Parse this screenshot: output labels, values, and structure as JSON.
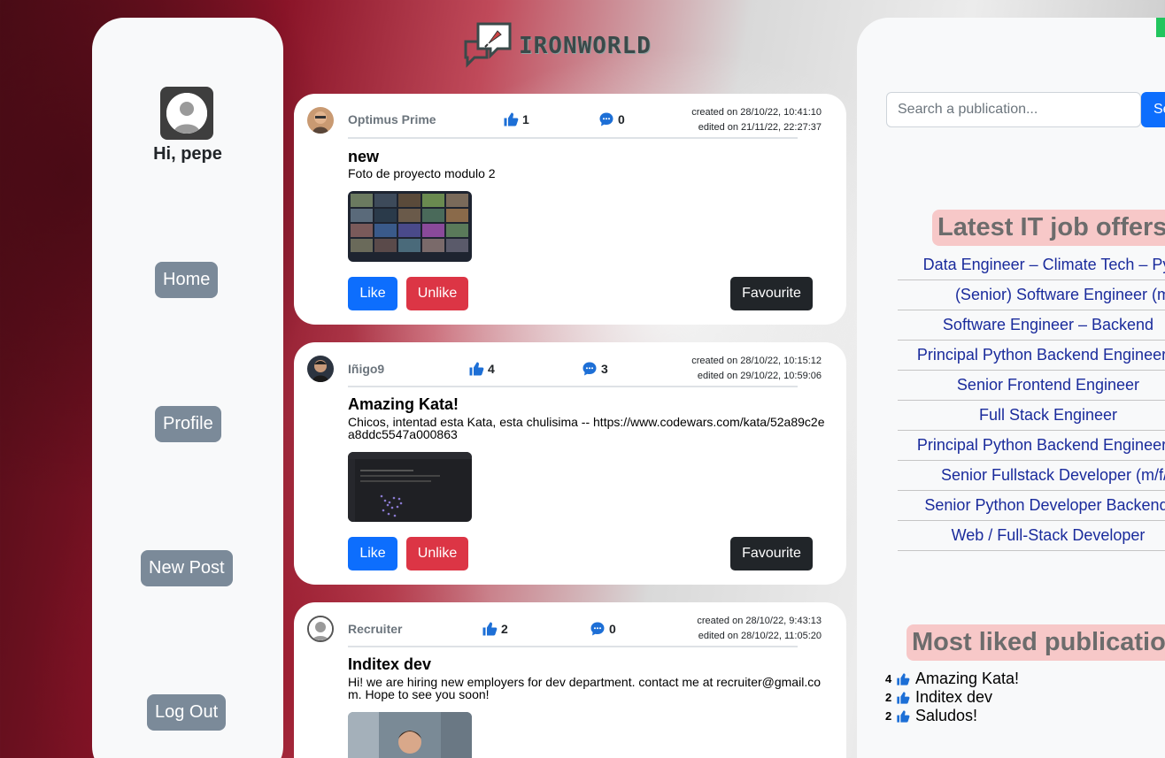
{
  "brand": {
    "name": "IRONWORLD"
  },
  "sidebar": {
    "greeting": "Hi, pepe",
    "nav": [
      "Home",
      "Profile",
      "New Post",
      "Log Out"
    ]
  },
  "posts": [
    {
      "author": "Optimus Prime",
      "likes": "1",
      "comments": "0",
      "created": "created on 28/10/22, 10:41:10",
      "edited": "edited on 21/11/22, 22:27:37",
      "title": "new",
      "body": "Foto de proyecto modulo 2",
      "like_label": "Like",
      "unlike_label": "Unlike",
      "fav_label": "Favourite"
    },
    {
      "author": "Iñigo9",
      "likes": "4",
      "comments": "3",
      "created": "created on 28/10/22, 10:15:12",
      "edited": "edited on 29/10/22, 10:59:06",
      "title": "Amazing Kata!",
      "body": "Chicos, intentad esta Kata, esta chulisima -- https://www.codewars.com/kata/52a89c2ea8ddc5547a000863",
      "like_label": "Like",
      "unlike_label": "Unlike",
      "fav_label": "Favourite"
    },
    {
      "author": "Recruiter",
      "likes": "2",
      "comments": "0",
      "created": "created on 28/10/22, 9:43:13",
      "edited": "edited on 28/10/22, 11:05:20",
      "title": "Inditex dev",
      "body": "Hi! we are hiring new employers for dev department. contact me at recruiter@gmail.com. Hope to see you soon!"
    }
  ],
  "search": {
    "placeholder": "Search a publication...",
    "button": "Se"
  },
  "jobs": {
    "title": "Latest IT job offers",
    "items": [
      "Data Engineer – Climate Tech – Pyth",
      "(Senior) Software Engineer (m/f/d)",
      "Software Engineer – Backend",
      "Principal Python Backend Engineer (m",
      "Senior Frontend Engineer",
      "Full Stack Engineer",
      "Principal Python Backend Engineer (m",
      "Senior Fullstack Developer (m/f/d)",
      "Senior Python Developer Backend (m",
      "Web / Full-Stack Developer"
    ]
  },
  "most_liked": {
    "title": "Most liked publication",
    "items": [
      {
        "count": "4",
        "title": "Amazing Kata!"
      },
      {
        "count": "2",
        "title": "Inditex dev"
      },
      {
        "count": "2",
        "title": "Saludos!"
      }
    ]
  },
  "colors": {
    "primary": "#0d6efd",
    "danger": "#dc3545",
    "dark": "#212529",
    "nav": "#7b8a99",
    "section_bg": "#f7c8c8",
    "job_link": "#1a2b9c"
  },
  "icons": [
    "thumbs-up-icon",
    "comment-icon",
    "user-avatar-icon",
    "chat-rocket-logo-icon"
  ]
}
